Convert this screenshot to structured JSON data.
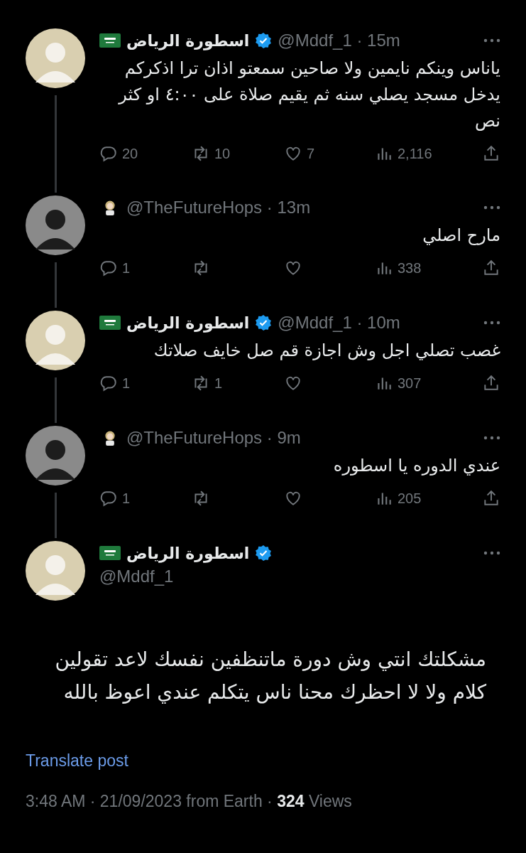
{
  "replies": [
    {
      "author": {
        "kind": "flag",
        "name": "اسطورة الرياض",
        "verified": true
      },
      "meta": "@Mddf_1 · 15m",
      "text": "ياناس وينكم نايمين ولا صاحين سمعتو اذان ترا اذكركم يدخل مسجد يصلي سنه ثم يقيم صلاة على ٤:٠٠ او كثر نص",
      "stats": {
        "replies": "20",
        "reposts": "10",
        "likes": "7",
        "views": "2,116"
      }
    },
    {
      "author": {
        "kind": "astronaut",
        "verified": false
      },
      "meta": "@TheFutureHops · 13m",
      "text": "مارح اصلي",
      "stats": {
        "replies": "1",
        "views": "338"
      }
    },
    {
      "author": {
        "kind": "flag",
        "name": "اسطورة الرياض",
        "verified": true
      },
      "meta": "@Mddf_1 · 10m",
      "text": "غصب تصلي اجل وش اجازة قم صل خايف صلاتك",
      "stats": {
        "replies": "1",
        "reposts": "1",
        "views": "307"
      }
    },
    {
      "author": {
        "kind": "astronaut",
        "verified": false
      },
      "meta": "@TheFutureHops · 9m",
      "text": "عندي الدوره يا اسطوره",
      "stats": {
        "replies": "1",
        "views": "205"
      }
    }
  ],
  "main_post": {
    "author": {
      "kind": "flag",
      "name": "اسطورة الرياض",
      "verified": true
    },
    "handle": "@Mddf_1",
    "text": "مشكلتك انتي وش دورة ماتنظفين نفسك لاعد تقولين كلام ولا لا احظرك محنا ناس يتكلم عندي اعوظ بالله",
    "translate": "Translate post",
    "footer": "3:48 AM · 21/09/2023 from Earth · **324** Views"
  }
}
